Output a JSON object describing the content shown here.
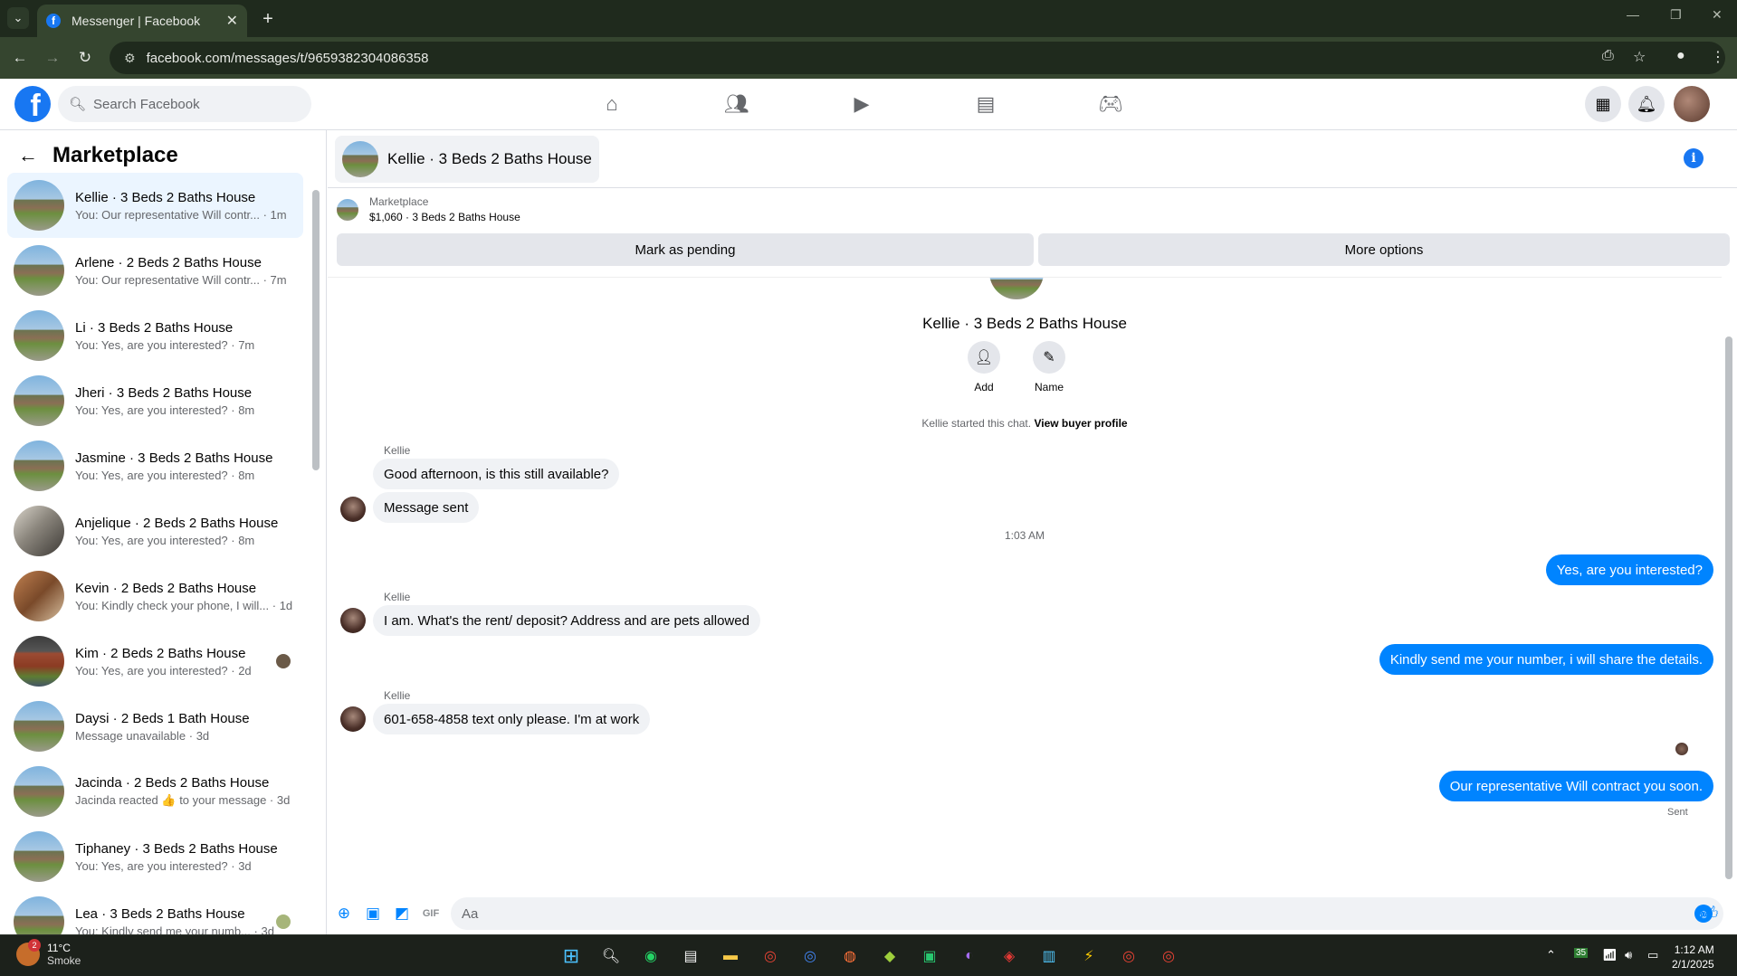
{
  "browser": {
    "tab_title": "Messenger | Facebook",
    "url": "facebook.com/messages/t/9659382304086358"
  },
  "facebook": {
    "search_placeholder": "Search Facebook"
  },
  "sidebar": {
    "title": "Marketplace",
    "conversations": [
      {
        "name": "Kellie · 3 Beds 2 Baths House",
        "preview": "You: Our representative Will contr... · 1m",
        "thumb": "house",
        "active": true
      },
      {
        "name": "Arlene · 2 Beds 2 Baths House",
        "preview": "You: Our representative Will contr... · 7m",
        "thumb": "house"
      },
      {
        "name": "Li · 3 Beds 2 Baths House",
        "preview": "You: Yes, are you interested? · 7m",
        "thumb": "house"
      },
      {
        "name": "Jheri · 3 Beds 2 Baths House",
        "preview": "You: Yes, are you interested? · 8m",
        "thumb": "house"
      },
      {
        "name": "Jasmine · 3 Beds 2 Baths House",
        "preview": "You: Yes, are you interested? · 8m",
        "thumb": "house"
      },
      {
        "name": "Anjelique · 2 Beds 2 Baths House",
        "preview": "You: Yes, are you interested? · 8m",
        "thumb": "int"
      },
      {
        "name": "Kevin · 2 Beds 2 Baths House",
        "preview": "You: Kindly check your phone, I will... · 1d",
        "thumb": "wood"
      },
      {
        "name": "Kim · 2 Beds 2 Baths House",
        "preview": "You: Yes, are you interested? · 2d",
        "thumb": "brick",
        "seen": true
      },
      {
        "name": "Daysi · 2 Beds 1 Bath House",
        "preview": "Message unavailable · 3d",
        "thumb": "house"
      },
      {
        "name": "Jacinda · 2 Beds 2 Baths House",
        "preview": "Jacinda reacted 👍 to your message · 3d",
        "thumb": "house"
      },
      {
        "name": "Tiphaney · 3 Beds 2 Baths House",
        "preview": "You: Yes, are you interested? · 3d",
        "thumb": "house"
      },
      {
        "name": "Lea · 3 Beds 2 Baths House",
        "preview": "You: Kindly send me your numb... · 3d",
        "thumb": "house",
        "seen_green": true
      }
    ]
  },
  "chat": {
    "title": "Kellie · 3 Beds 2 Baths House",
    "marketplace_label": "Marketplace",
    "listing": "$1,060 · 3 Beds 2 Baths House",
    "mark_pending": "Mark as pending",
    "more_options": "More options",
    "profile_name": "Kellie · 3 Beds 2 Baths House",
    "add_label": "Add",
    "name_label": "Name",
    "started_text": "Kellie started this chat.",
    "view_buyer": "View buyer profile",
    "sender": "Kellie",
    "msg1": "Good afternoon, is this still available?",
    "msg2": "Message sent",
    "time_sep": "1:03 AM",
    "out1": "Yes, are you interested?",
    "msg3": "I am. What's the rent/ deposit? Address and are pets allowed",
    "out2": "Kindly send me your number, i will share the details.",
    "msg4": "601-658-4858 text only please.  I'm at work",
    "out3": "Our representative Will contract you soon.",
    "sent_label": "Sent",
    "composer_placeholder": "Aa"
  },
  "taskbar": {
    "temp": "11°C",
    "condition": "Smoke",
    "weather_badge": "2",
    "time": "1:12 AM",
    "date": "2/1/2025",
    "tray_badge": "35"
  }
}
